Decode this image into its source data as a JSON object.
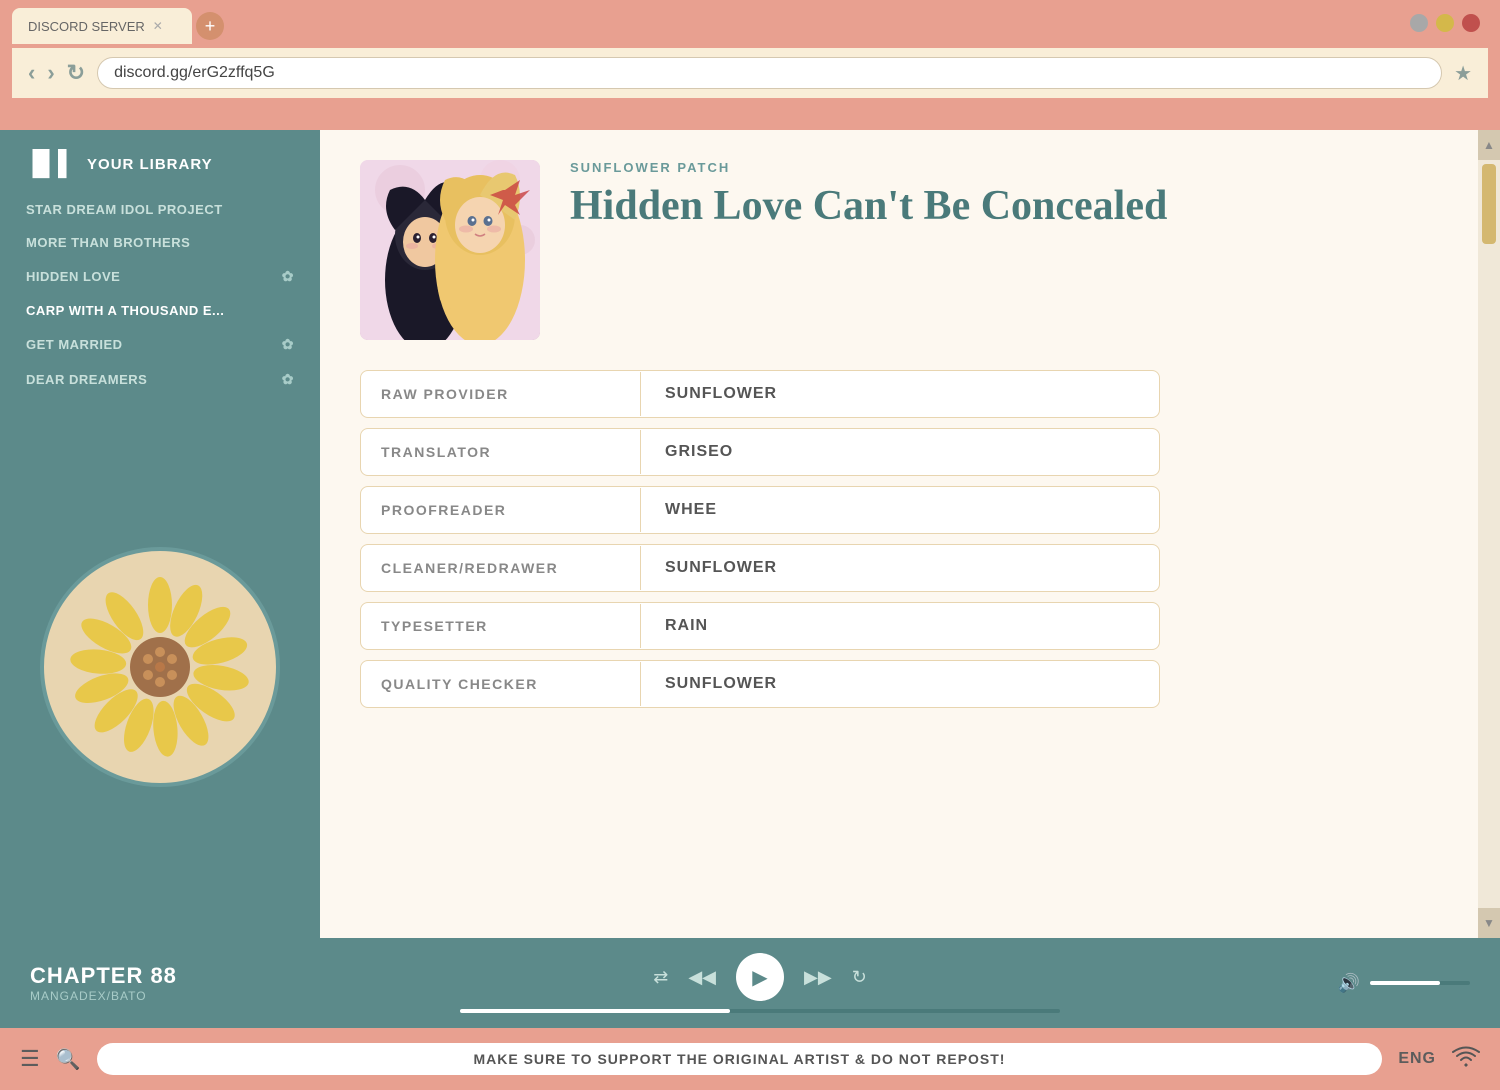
{
  "browser": {
    "tab_text": "DISCORD SERVER",
    "tab_add": "+",
    "address": "discord.gg/erG2zffq5G",
    "bookmark_icon": "★",
    "back": "‹",
    "forward": "›",
    "refresh": "↻"
  },
  "sidebar": {
    "title": "YOUR LIBRARY",
    "icon": "|||",
    "items": [
      {
        "label": "STAR DREAM IDOL PROJECT",
        "icon": null
      },
      {
        "label": "MORE THAN BROTHERS",
        "icon": null
      },
      {
        "label": "HIDDEN LOVE",
        "icon": "✿"
      },
      {
        "label": "CARP WITH A THOUSAND E...",
        "icon": null
      },
      {
        "label": "GET MARRIED",
        "icon": "✿"
      },
      {
        "label": "DEAR DREAMERS",
        "icon": "✿"
      }
    ]
  },
  "book": {
    "publisher": "SUNFLOWER PATCH",
    "title": "Hidden Love Can't Be Concealed"
  },
  "credits": [
    {
      "role": "RAW PROVIDER",
      "name": "SUNFLOWER"
    },
    {
      "role": "TRANSLATOR",
      "name": "GRISEO"
    },
    {
      "role": "PROOFREADER",
      "name": "WHEE"
    },
    {
      "role": "CLEANER/REDRAWER",
      "name": "SUNFLOWER"
    },
    {
      "role": "TYPESETTER",
      "name": "RAIN"
    },
    {
      "role": "QUALITY CHECKER",
      "name": "SUNFLOWER"
    }
  ],
  "player": {
    "chapter": "CHAPTER 88",
    "source": "MANGADEX/BATO",
    "shuffle": "⇄",
    "prev": "◀◀",
    "play": "▶",
    "next": "▶▶",
    "repeat": "↻",
    "volume_icon": "🔊"
  },
  "statusbar": {
    "notice": "MAKE SURE TO SUPPORT THE ORIGINAL ARTIST & DO NOT REPOST!",
    "lang": "ENG",
    "menu_icon": "☰",
    "search_icon": "🔍",
    "wifi_icon": "📶"
  },
  "window_controls": {
    "colors": [
      "#a0a0a0",
      "#d4b84a",
      "#c0504d"
    ]
  }
}
